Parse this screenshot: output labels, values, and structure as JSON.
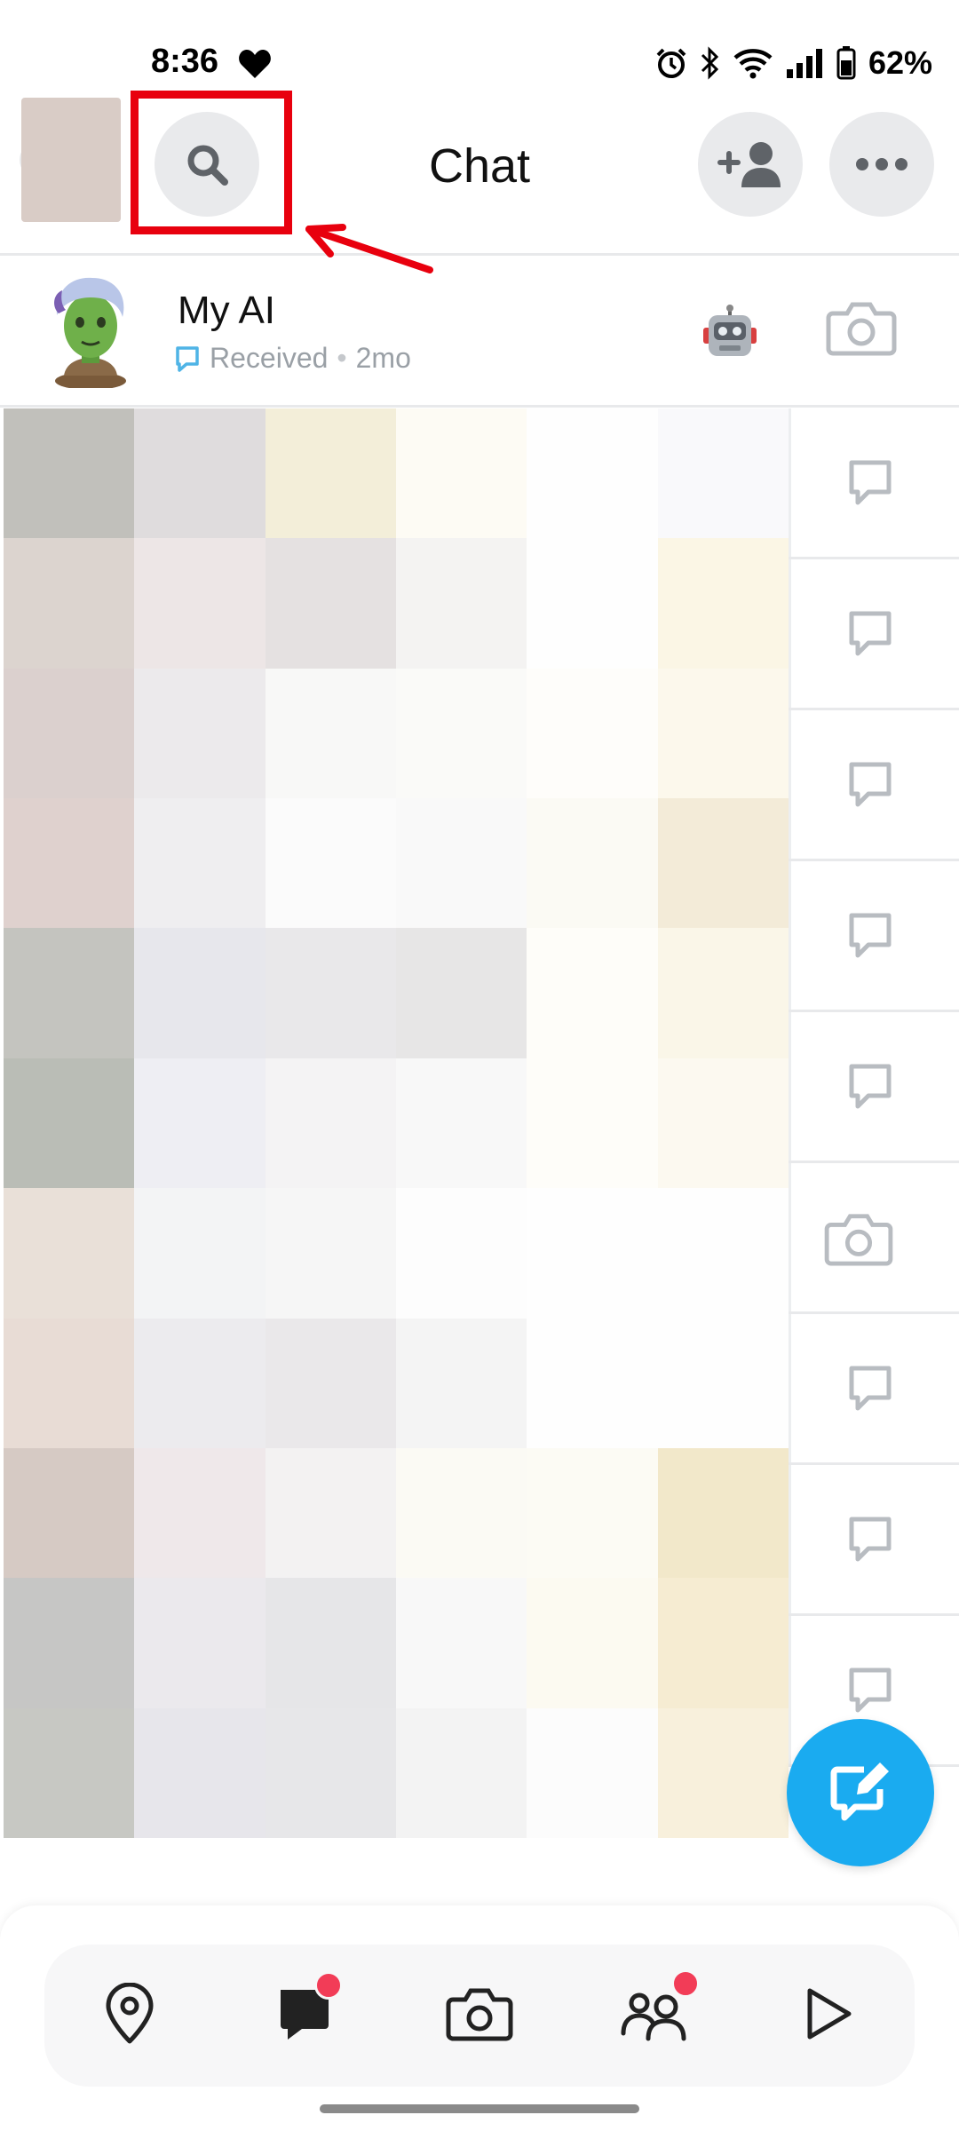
{
  "status_bar": {
    "time": "8:36",
    "battery": "62%",
    "icons": [
      "heart-icon",
      "alarm-icon",
      "bluetooth-icon",
      "wifi-icon",
      "signal-icon",
      "battery-icon"
    ]
  },
  "header": {
    "title": "Chat",
    "search_icon": "search-icon",
    "add_friend_icon": "add-friend-icon",
    "more_icon": "more-icon",
    "highlight_color": "#e8000e"
  },
  "chats": {
    "my_ai": {
      "name": "My AI",
      "status": "Received",
      "separator": "•",
      "time": "2mo"
    },
    "row_icons": [
      "chat-icon",
      "chat-icon",
      "chat-icon",
      "chat-icon",
      "chat-icon",
      "camera-icon",
      "chat-icon",
      "chat-icon",
      "chat-icon"
    ]
  },
  "colors": {
    "accent": "#1aabf0",
    "badge": "#f23c57",
    "icon_gray": "#b8bcc1"
  },
  "bottom_nav": {
    "items": [
      "map-icon",
      "chat-nav-icon",
      "camera-nav-icon",
      "stories-icon",
      "spotlight-icon"
    ],
    "badges_on": [
      "chat-nav-icon",
      "stories-icon"
    ]
  }
}
